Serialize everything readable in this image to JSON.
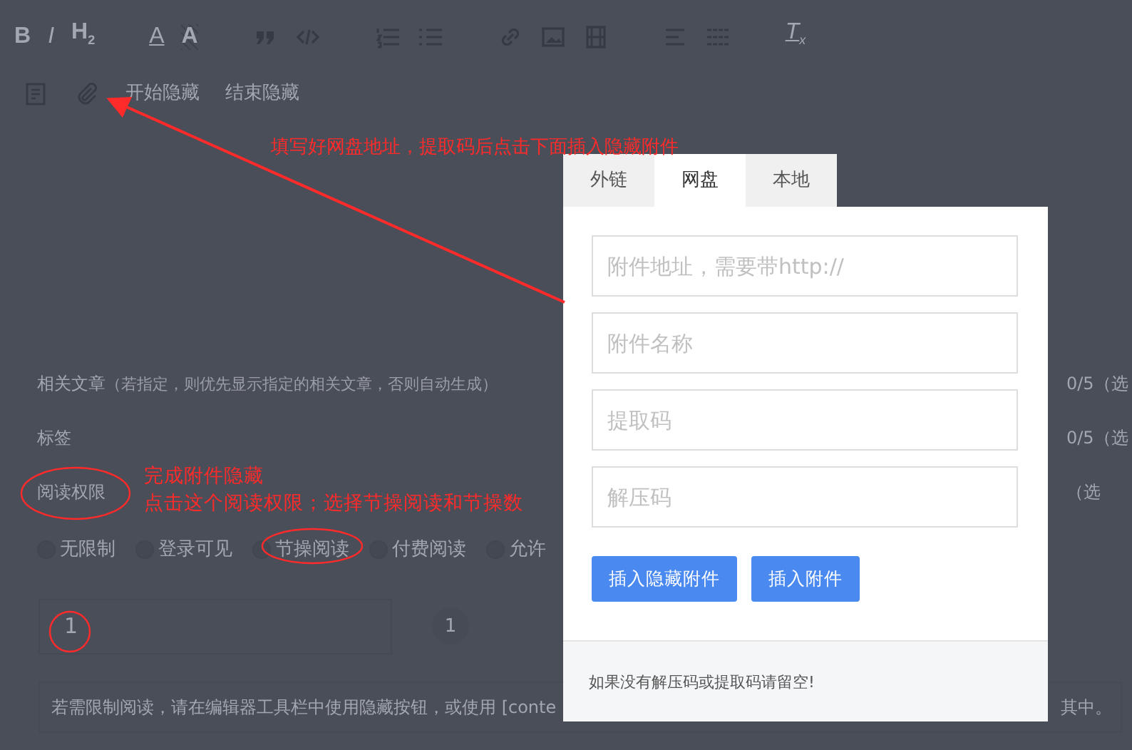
{
  "toolbar": {
    "tools": [
      {
        "kind": "bold",
        "label": "B"
      },
      {
        "kind": "italic",
        "label": "I"
      },
      {
        "kind": "heading",
        "label": "H",
        "sub": "2"
      },
      {
        "kind": "sep"
      },
      {
        "kind": "font-color",
        "label": "A"
      },
      {
        "kind": "highlight",
        "label": "A"
      },
      {
        "kind": "sep"
      },
      {
        "kind": "quote"
      },
      {
        "kind": "code"
      },
      {
        "kind": "sep"
      },
      {
        "kind": "ol"
      },
      {
        "kind": "ul"
      },
      {
        "kind": "sep"
      },
      {
        "kind": "link"
      },
      {
        "kind": "image"
      },
      {
        "kind": "video"
      },
      {
        "kind": "sep"
      },
      {
        "kind": "align"
      },
      {
        "kind": "justify"
      },
      {
        "kind": "sep"
      },
      {
        "kind": "clear",
        "label": "T",
        "sub": "x"
      }
    ],
    "row2": [
      {
        "kind": "doc"
      },
      {
        "kind": "attach"
      },
      {
        "kind": "text",
        "label": "开始隐藏"
      },
      {
        "kind": "text",
        "label": "结束隐藏"
      }
    ]
  },
  "fields": [
    {
      "label": "相关文章",
      "hint": "（若指定，则优先显示指定的相关文章，否则自动生成）",
      "count": "0/5（选"
    },
    {
      "label": "标签",
      "count": "0/5（选"
    },
    {
      "label": "阅读权限",
      "count": "（选"
    }
  ],
  "read_options": [
    {
      "label": "无限制",
      "selected": false
    },
    {
      "label": "登录可见",
      "selected": false
    },
    {
      "label": "节操阅读",
      "selected": false
    },
    {
      "label": "付费阅读",
      "selected": false
    },
    {
      "label": "允许",
      "selected": false
    }
  ],
  "points": {
    "value": "1",
    "badge": "1"
  },
  "notice": {
    "text": "若需限制阅读，请在编辑器工具栏中使用隐藏按钮，或使用 [conte",
    "tail": "其中。"
  },
  "dialog": {
    "tabs": [
      {
        "label": "外链",
        "selected": false
      },
      {
        "label": "网盘",
        "selected": true
      },
      {
        "label": "本地",
        "selected": false
      }
    ],
    "inputs": [
      {
        "placeholder": "附件地址，需要带http://"
      },
      {
        "placeholder": "附件名称"
      },
      {
        "placeholder": "提取码"
      },
      {
        "placeholder": "解压码"
      }
    ],
    "buttons": [
      "插入隐藏附件",
      "插入附件"
    ],
    "footer": "如果没有解压码或提取码请留空!"
  },
  "annotations": {
    "top": "填写好网盘地址，提取码后点击下面插入隐藏附件",
    "lines": [
      "完成附件隐藏",
      "点击这个阅读权限；选择节操阅读和节操数"
    ]
  }
}
